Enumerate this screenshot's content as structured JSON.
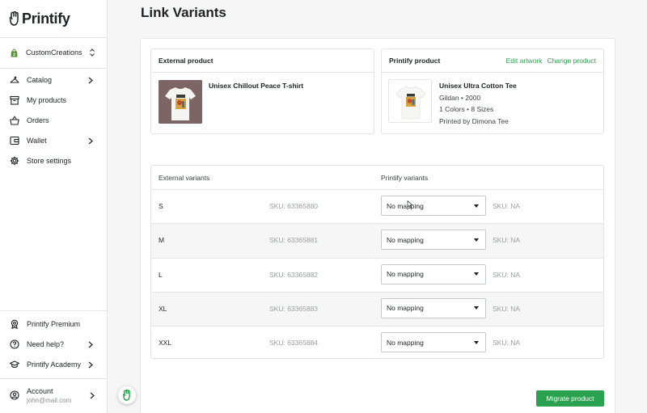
{
  "app": {
    "logo_text": "Printify",
    "brand_color": "#29a14e"
  },
  "sidebar": {
    "store_name": "CustomCreations",
    "items": [
      {
        "label": "Catalog",
        "icon": "hanger-icon",
        "has_arrow": true
      },
      {
        "label": "My products",
        "icon": "archive-icon",
        "has_arrow": false
      },
      {
        "label": "Orders",
        "icon": "basket-icon",
        "has_arrow": false
      },
      {
        "label": "Wallet",
        "icon": "wallet-icon",
        "has_arrow": true
      },
      {
        "label": "Store settings",
        "icon": "gear-icon",
        "has_arrow": false
      }
    ],
    "bottom_items": [
      {
        "label": "Printify Premium",
        "icon": "badge-icon"
      },
      {
        "label": "Need help?",
        "icon": "help-icon"
      },
      {
        "label": "Printify Academy",
        "icon": "graduation-cap-icon"
      }
    ],
    "account": {
      "label": "Account",
      "email": "john@mail.com"
    }
  },
  "page": {
    "title": "Link Variants"
  },
  "external_product": {
    "header": "External product",
    "name": "Unisex Chillout Peace T-shirt"
  },
  "printify_product": {
    "header": "Printify product",
    "edit_link": "Edit artwork",
    "change_link": "Change product",
    "name": "Unisex Ultra Cotton Tee",
    "brand_line": "Gildan • 2000",
    "options_line": "1 Colors • 8 Sizes",
    "printer_line": "Printed by Dimona Tee"
  },
  "variants_table": {
    "col_external": "External variants",
    "col_printify": "Printify variants",
    "rows": [
      {
        "size": "S",
        "sku": "SKU: 63365880",
        "mapping": "No mapping",
        "printify_sku": "SKU: NA"
      },
      {
        "size": "M",
        "sku": "SKU: 63365881",
        "mapping": "No mapping",
        "printify_sku": "SKU: NA"
      },
      {
        "size": "L",
        "sku": "SKU: 63365882",
        "mapping": "No mapping",
        "printify_sku": "SKU: NA"
      },
      {
        "size": "XL",
        "sku": "SKU: 63365883",
        "mapping": "No mapping",
        "printify_sku": "SKU: NA"
      },
      {
        "size": "XXL",
        "sku": "SKU: 63365884",
        "mapping": "No mapping",
        "printify_sku": "SKU: NA"
      }
    ]
  },
  "actions": {
    "migrate_label": "Migrate product"
  }
}
